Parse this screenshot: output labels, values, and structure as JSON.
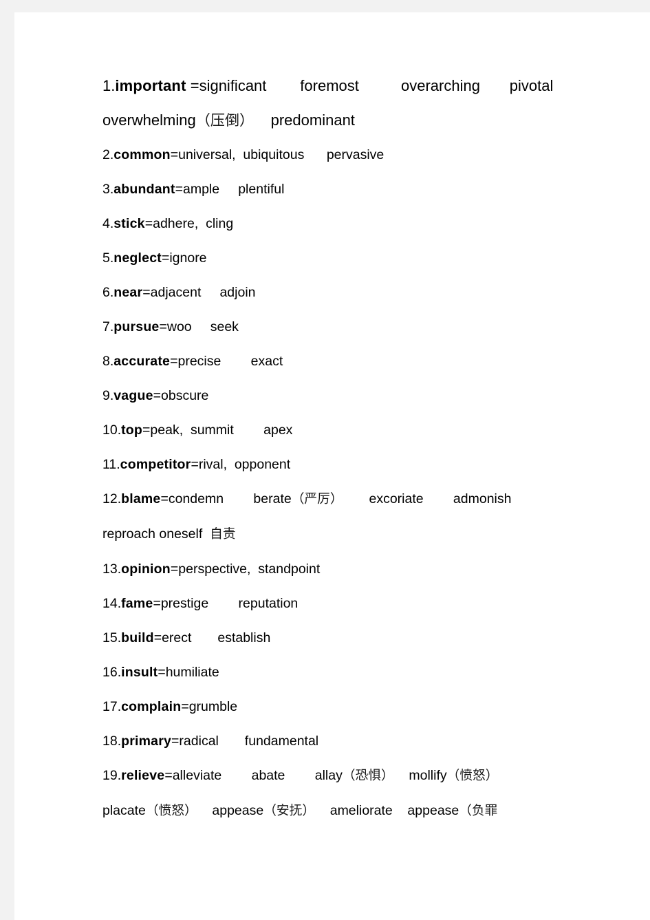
{
  "page": {
    "background_color": "#f2f2f2",
    "paper_color": "#ffffff",
    "text_color": "#000000"
  },
  "entries": [
    {
      "number": "1.",
      "headword": "important",
      "synonyms_line": " =significant        foremost          overarching       pivotal",
      "wrapped_lines": [
        {
          "text": "overwhelming",
          "cn": "（压倒）",
          "tail": "    predominant"
        }
      ]
    },
    {
      "number": "2.",
      "headword": "common",
      "synonyms_line": "=universal,  ubiquitous      pervasive",
      "wrapped_lines": []
    },
    {
      "number": "3.",
      "headword": "abundant",
      "synonyms_line": "=ample     plentiful",
      "wrapped_lines": []
    },
    {
      "number": "4.",
      "headword": "stick",
      "synonyms_line": "=adhere,  cling",
      "wrapped_lines": []
    },
    {
      "number": "5.",
      "headword": "neglect",
      "synonyms_line": "=ignore",
      "wrapped_lines": []
    },
    {
      "number": "6.",
      "headword": "near",
      "synonyms_line": "=adjacent     adjoin",
      "wrapped_lines": []
    },
    {
      "number": "7.",
      "headword": "pursue",
      "synonyms_line": "=woo     seek",
      "wrapped_lines": []
    },
    {
      "number": "8.",
      "headword": "accurate",
      "synonyms_line": "=precise        exact",
      "wrapped_lines": []
    },
    {
      "number": "9.",
      "headword": "vague",
      "synonyms_line": "=obscure",
      "wrapped_lines": []
    },
    {
      "number": "10.",
      "headword": "top",
      "synonyms_line": "=peak,  summit        apex",
      "wrapped_lines": []
    },
    {
      "number": "11.",
      "headword": "competitor",
      "synonyms_line": "=rival,  opponent",
      "wrapped_lines": []
    },
    {
      "number": "12.",
      "headword": "blame",
      "synonyms_line": "=condemn        berate",
      "synonyms_cn": "（严厉）",
      "synonyms_tail": "       excoriate        admonish",
      "wrapped_lines": [
        {
          "text": "reproach oneself  ",
          "cn": "自责",
          "tail": ""
        }
      ]
    },
    {
      "number": "13.",
      "headword": "opinion",
      "synonyms_line": "=perspective,  standpoint",
      "wrapped_lines": []
    },
    {
      "number": "14.",
      "headword": "fame",
      "synonyms_line": "=prestige        reputation",
      "wrapped_lines": []
    },
    {
      "number": "15.",
      "headword": "build",
      "synonyms_line": "=erect       establish",
      "wrapped_lines": []
    },
    {
      "number": "16.",
      "headword": "insult",
      "synonyms_line": "=humiliate",
      "wrapped_lines": []
    },
    {
      "number": "17.",
      "headword": "complain",
      "synonyms_line": "=grumble",
      "wrapped_lines": []
    },
    {
      "number": "18.",
      "headword": "primary",
      "synonyms_line": "=radical       fundamental",
      "wrapped_lines": []
    },
    {
      "number": "19.",
      "headword": "relieve",
      "synonyms_line": "=alleviate        abate        allay",
      "synonyms_cn": "（恐惧）",
      "synonyms_tail2": "    mollify",
      "synonyms_cn2": "（愤怒）",
      "wrapped_lines": [
        {
          "text": "placate",
          "cn": "（愤怒）",
          "tail": "    appease",
          "cn2": "（安抚）",
          "tail2": "    ameliorate    appease",
          "cn3": "（负罪"
        }
      ]
    }
  ]
}
